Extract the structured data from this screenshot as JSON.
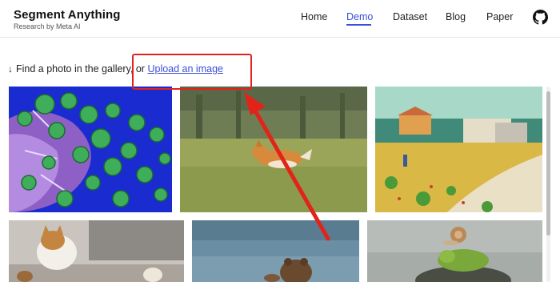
{
  "header": {
    "title": "Segment Anything",
    "subtitle": "Research by Meta AI",
    "nav": [
      {
        "label": "Home",
        "active": false
      },
      {
        "label": "Demo",
        "active": true
      },
      {
        "label": "Dataset",
        "active": false
      },
      {
        "label": "Blog",
        "active": false
      },
      {
        "label": "Paper",
        "active": false
      }
    ],
    "github_icon": "github-icon"
  },
  "main": {
    "prompt_icon": "↓",
    "prompt_text": "Find a photo in the gallery, or",
    "upload_link": "Upload an image"
  },
  "gallery": {
    "images": [
      "bacteria-cells",
      "running-corgi-dog",
      "van-gogh-landscape-painting",
      "cats-on-street",
      "bear-in-water",
      "frog-and-snail-on-turtle"
    ]
  },
  "annotation": {
    "color": "#e2231a"
  },
  "colors": {
    "accent": "#3b4fd8"
  }
}
